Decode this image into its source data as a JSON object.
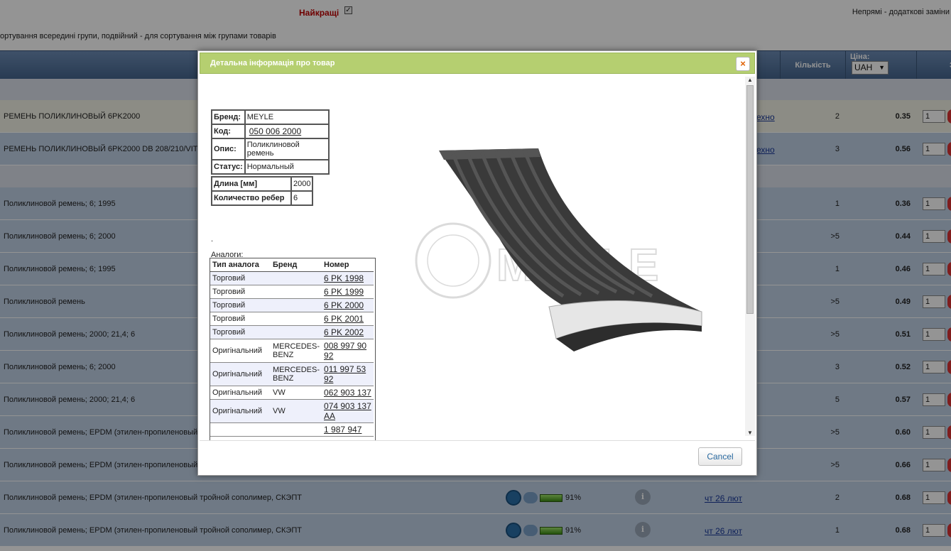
{
  "page": {
    "best_label": "Найкращі",
    "indirect_label": "Непрямі - додаткові заміни",
    "sort_note": "ортування всередині групи, подвійний - для сортування між групами товарів"
  },
  "table": {
    "headers": {
      "qty": "Кількість",
      "price": "Ціна:",
      "order": "За"
    },
    "currency": "UAH",
    "rows": [
      {
        "name": "РЕМЕНЬ ПОЛИКЛИНОВЫЙ 6PK2000",
        "date": "ехно",
        "qty": "2",
        "price": "0.35",
        "order_qty": "1"
      },
      {
        "name": "РЕМЕНЬ ПОЛИКЛИНОВЫЙ 6PK2000 DB 208/210/VITO O",
        "date": "ехно",
        "qty": "3",
        "price": "0.56",
        "order_qty": "1"
      },
      {
        "name": "Поликлиновой ремень; 6; 1995",
        "date": "",
        "qty": "1",
        "price": "0.36",
        "order_qty": "1"
      },
      {
        "name": "Поликлиновой ремень; 6; 2000",
        "date": "",
        "qty": ">5",
        "price": "0.44",
        "order_qty": "1"
      },
      {
        "name": "Поликлиновой ремень; 6; 1995",
        "date": "",
        "qty": "1",
        "price": "0.46",
        "order_qty": "1"
      },
      {
        "name": "Поликлиновой ремень",
        "date": "",
        "qty": ">5",
        "price": "0.49",
        "order_qty": "1"
      },
      {
        "name": "Поликлиновой ремень; 2000; 21,4; 6",
        "date": "",
        "qty": ">5",
        "price": "0.51",
        "order_qty": "1"
      },
      {
        "name": "Поликлиновой ремень; 6; 2000",
        "date": "",
        "qty": "3",
        "price": "0.52",
        "order_qty": "1"
      },
      {
        "name": "Поликлиновой ремень; 2000; 21,4; 6",
        "date": "",
        "qty": "5",
        "price": "0.57",
        "order_qty": "1"
      },
      {
        "name": "Поликлиновой ремень; EPDM (этилен-пропиленовый т",
        "date": "",
        "qty": ">5",
        "price": "0.60",
        "order_qty": "1"
      },
      {
        "name": "Поликлиновой ремень; EPDM (этилен-пропиленовый т",
        "date": "",
        "qty": ">5",
        "price": "0.66",
        "order_qty": "1"
      },
      {
        "name": "Поликлиновой ремень; EPDM (этилен-пропиленовый тройной сополимер, СКЭПТ",
        "date": "чт 26 лют",
        "qty": "2",
        "price": "0.68",
        "order_qty": "1",
        "availability": "91%"
      },
      {
        "name": "Поликлиновой ремень; EPDM (этилен-пропиленовый тройной сополимер, СКЭПТ",
        "date": "чт 26 лют",
        "qty": "1",
        "price": "0.68",
        "order_qty": "1",
        "availability": "91%"
      }
    ]
  },
  "modal": {
    "title": "Детальна інформація про товар",
    "close_label": "×",
    "cancel_label": "Cancel",
    "info": {
      "brand_label": "Бренд:",
      "brand": "MEYLE",
      "code_label": "Код:",
      "code": "050 006 2000",
      "desc_label": "Опис:",
      "desc": "Поликлиновой ремень",
      "status_label": "Статус:",
      "status": "Нормальный"
    },
    "specs": {
      "length_label": "Длина [мм]",
      "length": "2000",
      "ribs_label": "Количество ребер",
      "ribs": "6"
    },
    "dot": ".",
    "analogs_label": "Аналоги:",
    "analog_headers": {
      "type": "Тип аналога",
      "brand": "Бренд",
      "number": "Номер"
    },
    "analogs": [
      {
        "type": "Торговий",
        "brand": "",
        "number": "6 PK 1998"
      },
      {
        "type": "Торговий",
        "brand": "",
        "number": "6 PK 1999"
      },
      {
        "type": "Торговий",
        "brand": "",
        "number": "6 PK 2000"
      },
      {
        "type": "Торговий",
        "brand": "",
        "number": "6 PK 2001"
      },
      {
        "type": "Торговий",
        "brand": "",
        "number": "6 PK 2002"
      },
      {
        "type": "Оригінальний",
        "brand": "MERCEDES-BENZ",
        "number": "008 997 90 92"
      },
      {
        "type": "Оригінальний",
        "brand": "MERCEDES-BENZ",
        "number": "011 997 53 92"
      },
      {
        "type": "Оригінальний",
        "brand": "VW",
        "number": "062 903 137"
      },
      {
        "type": "Оригінальний",
        "brand": "VW",
        "number": "074 903 137 AA"
      },
      {
        "type": "",
        "brand": "",
        "number": "1 987 947"
      }
    ],
    "watermark": "MEYLE"
  },
  "colors": {
    "header_green": "#b5cf70",
    "row_blue": "#bfd0e6",
    "accent_red": "#c00000"
  }
}
